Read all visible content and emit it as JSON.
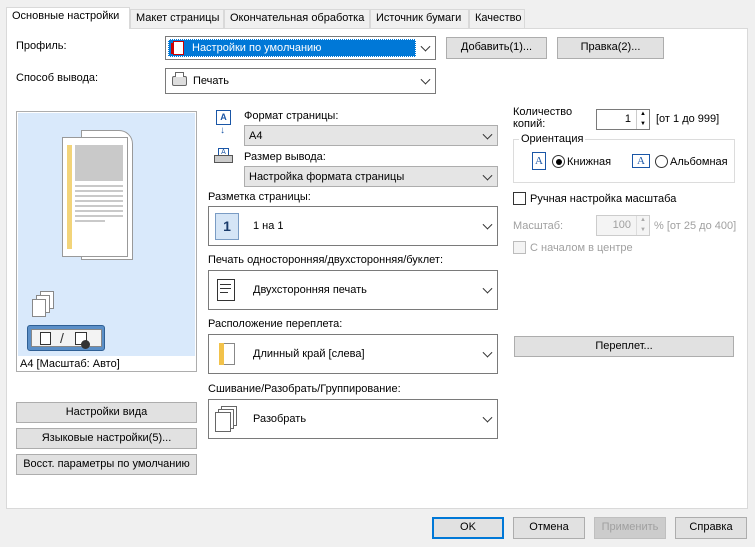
{
  "tabs": [
    "Основные настройки",
    "Макет страницы",
    "Окончательная обработка",
    "Источник бумаги",
    "Качество"
  ],
  "profile": {
    "label": "Профиль:",
    "value": "Настройки по умолчанию",
    "add_button": "Добавить(1)...",
    "edit_button": "Правка(2)..."
  },
  "output": {
    "label": "Способ вывода:",
    "value": "Печать"
  },
  "preview": {
    "caption": "А4 [Масштаб: Авто]",
    "view_settings_button": "Настройки вида",
    "language_button": "Языковые настройки(5)...",
    "restore_button": "Восст. параметры по умолчанию"
  },
  "page_size": {
    "label": "Формат страницы:",
    "value": "A4"
  },
  "output_size": {
    "label": "Размер вывода:",
    "value": "Настройка формата страницы"
  },
  "layout": {
    "label": "Разметка страницы:",
    "value": "1 на 1",
    "icon_digit": "1"
  },
  "duplex": {
    "label": "Печать односторонняя/двухсторонняя/буклет:",
    "value": "Двухсторонняя печать"
  },
  "binding": {
    "label": "Расположение переплета:",
    "value": "Длинный край [слева]"
  },
  "collate": {
    "label": "Сшивание/Разобрать/Группирование:",
    "value": "Разобрать"
  },
  "copies": {
    "label": "Количество копий:",
    "value": "1",
    "range": "[от 1 до 999]"
  },
  "orientation": {
    "legend": "Ориентация",
    "portrait": "Книжная",
    "landscape": "Альбомная",
    "selected": "portrait"
  },
  "manual_scale": {
    "label": "Ручная настройка масштаба",
    "checked": false
  },
  "scale": {
    "label": "Масштаб:",
    "value": "100",
    "range": "% [от 25 до 400]"
  },
  "center": {
    "label": "С началом в центре"
  },
  "gutter_button": "Переплет...",
  "footer": {
    "ok": "OK",
    "cancel": "Отмена",
    "apply": "Применить",
    "help": "Справка"
  }
}
